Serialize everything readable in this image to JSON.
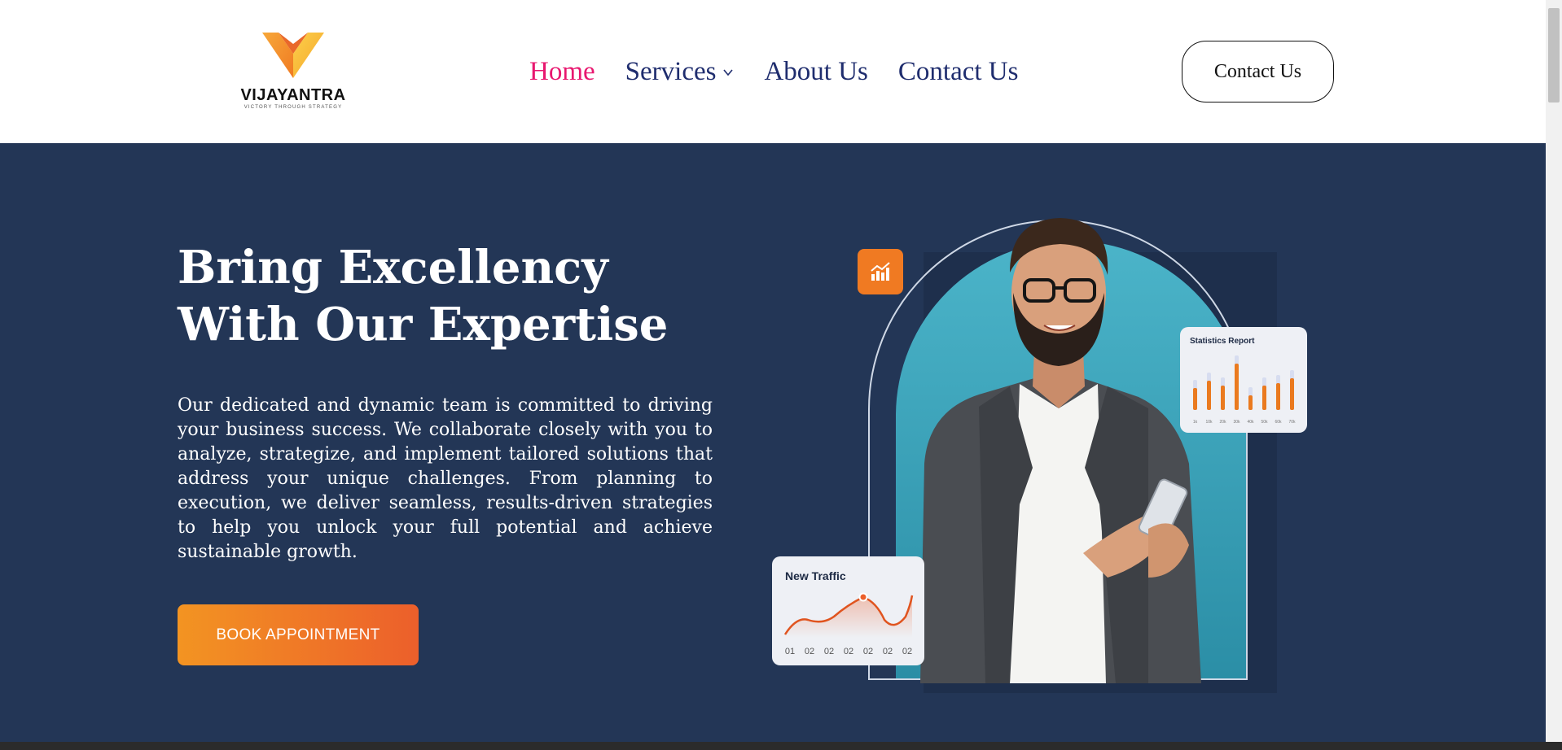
{
  "brand": {
    "name": "VIJAYANTRA",
    "tagline": "VICTORY THROUGH STRATEGY",
    "colors": {
      "orange": "#f39422",
      "orange_dark": "#ec5f2b",
      "navy": "#233656",
      "pink": "#e8176f",
      "nav_blue": "#1f2d6e"
    }
  },
  "nav": {
    "items": [
      {
        "label": "Home",
        "active": true
      },
      {
        "label": "Services",
        "has_dropdown": true
      },
      {
        "label": "About Us"
      },
      {
        "label": "Contact Us"
      }
    ],
    "cta_label": "Contact Us"
  },
  "hero": {
    "title": "Bring Excellency With Our Expertise",
    "text": "Our dedicated and dynamic team is committed to driving your business success. We collaborate closely with you to analyze, strategize, and implement tailored solutions that address your unique challenges. From planning to execution, we deliver seamless, results-driven strategies to help you unlock your full potential and achieve sustainable growth.",
    "button_label": "BOOK APPOINTMENT"
  },
  "illustration": {
    "stats_card": {
      "title": "Statistics Report",
      "labels": [
        "1k",
        "10k",
        "20k",
        "30k",
        "40k",
        "50k",
        "60k",
        "70k"
      ],
      "values": [
        0.45,
        0.6,
        0.5,
        0.95,
        0.3,
        0.5,
        0.55,
        0.65
      ]
    },
    "traffic_card": {
      "title": "New Traffic",
      "labels": [
        "01",
        "02",
        "02",
        "02",
        "02",
        "02",
        "02"
      ]
    },
    "icons": [
      "chart-growth-icon"
    ]
  }
}
